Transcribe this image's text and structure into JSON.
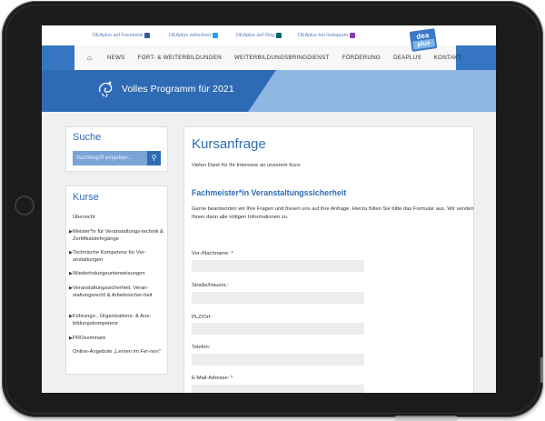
{
  "social": [
    {
      "label": "DEAplus auf Facebook",
      "icon": "facebook-icon",
      "color": "#3b5998"
    },
    {
      "label": "DEAplus zwitschert",
      "icon": "twitter-icon",
      "color": "#1da1f2"
    },
    {
      "label": "DEAplus auf Xing",
      "icon": "xing-icon",
      "color": "#026466"
    },
    {
      "label": "DEAplus bei Instagram",
      "icon": "instagram-icon",
      "color": "#8a3ab9"
    }
  ],
  "logo": {
    "top": "dea",
    "bottom": "plus"
  },
  "nav": {
    "home_icon": "home-icon",
    "items": [
      "NEWS",
      "FORT- & WEITERBILDUNGEN",
      "WEITERBILDUNGSBRINGDIENST",
      "FÖRDERUNG",
      "DEAPLUS",
      "KONTAKT"
    ]
  },
  "banner": {
    "text": "Volles Programm für 2021",
    "icon": "doodle-icon"
  },
  "search": {
    "title": "Suche",
    "placeholder": "Suchbegriff eingeben...",
    "button_icon": "search-icon"
  },
  "courses": {
    "title": "Kurse",
    "items": [
      {
        "label": "Übersicht",
        "arrow": false
      },
      {
        "label": "Meister*in für Veranstaltungs-technik & Zertifikatslehrgänge",
        "arrow": true
      },
      {
        "label": "Technische Kompetenz für Ver-anstaltungen",
        "arrow": true
      },
      {
        "label": "Wiederholungsunterweisungen",
        "arrow": true
      },
      {
        "label": "Veranstaltungssicherheit, Veran-staltungsrecht & Arbeitssicher-heit",
        "arrow": true
      },
      {
        "label": "Führungs-, Organisations- & Aus-bildungskompetenz",
        "arrow": true
      },
      {
        "label": "PROseminare",
        "arrow": true
      },
      {
        "label": "Online-Angebote „Lernen im Fer-nen\"",
        "arrow": false
      }
    ]
  },
  "main": {
    "title": "Kursanfrage",
    "intro": "Vielen Dank für Ihr Interesse an unserem Kurs:",
    "course_name": "Fachmeister*in Veranstaltungssicherheit",
    "description": "Gerne beantworten wir Ihre Fragen und freuen uns auf Ihre Anfrage. Hierzu füllen Sie bitte das Formular aus. Wir senden Ihnen dann alle nötigen Informationen zu.",
    "fields": [
      {
        "label": "Vor-/Nachname: *",
        "value": ""
      },
      {
        "label": "Straße/Hausnr.:",
        "value": ""
      },
      {
        "label": "PLZ/Ort:",
        "value": ""
      },
      {
        "label": "Telefon:",
        "value": ""
      },
      {
        "label": "E-Mail-Adresse: *",
        "value": ""
      }
    ]
  }
}
